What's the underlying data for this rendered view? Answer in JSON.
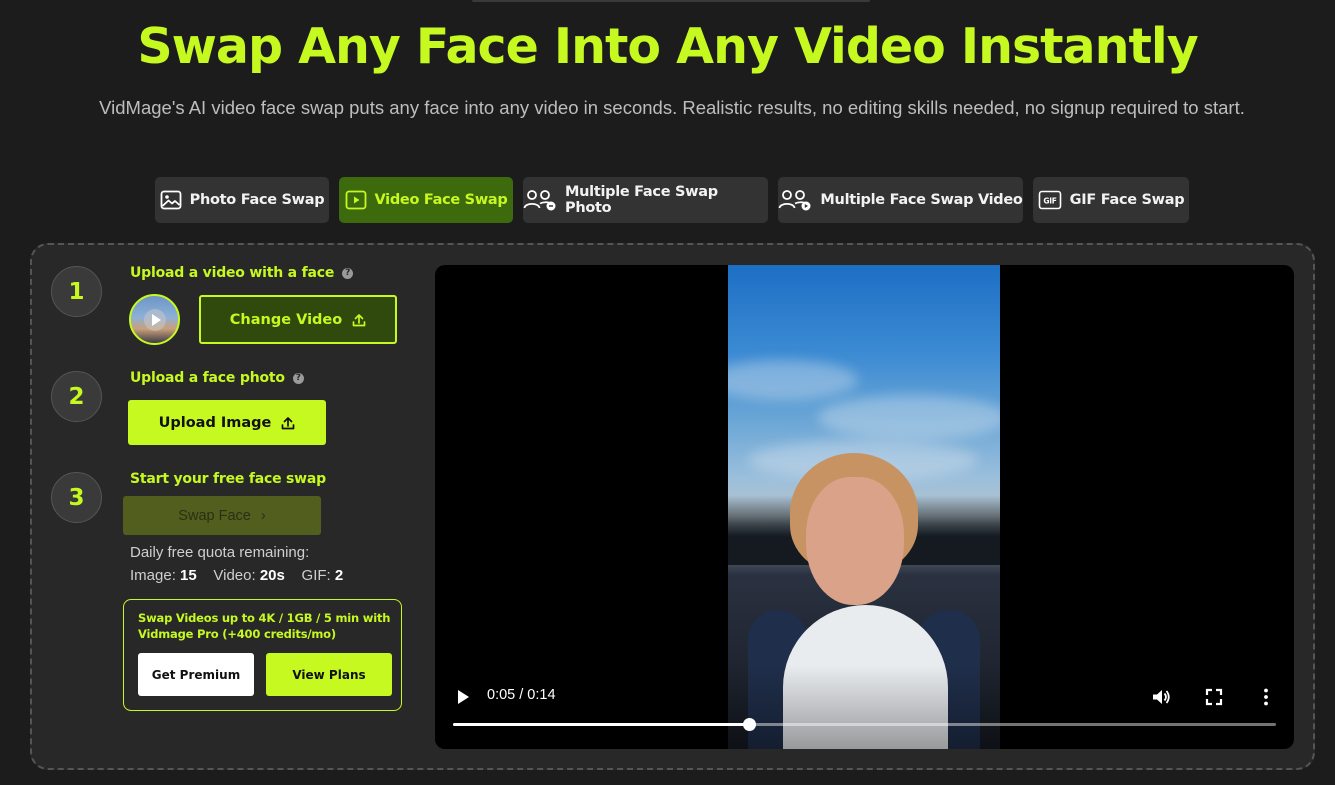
{
  "hero": {
    "title": "Swap Any Face Into Any Video Instantly",
    "subtitle": "VidMage's AI video face swap puts any face into any video in seconds. Realistic results, no editing skills needed, no signup required to start."
  },
  "tabs": [
    {
      "label": "Photo Face Swap",
      "icon": "image-icon",
      "active": false
    },
    {
      "label": "Video Face Swap",
      "icon": "video-icon",
      "active": true
    },
    {
      "label": "Multiple Face Swap Photo",
      "icon": "multi-user-icon",
      "active": false
    },
    {
      "label": "Multiple Face Swap Video",
      "icon": "multi-user-icon",
      "active": false
    },
    {
      "label": "GIF Face Swap",
      "icon": "gif-icon",
      "active": false
    }
  ],
  "steps": {
    "step1": {
      "number": "1",
      "label": "Upload a video with a face",
      "button": "Change Video"
    },
    "step2": {
      "number": "2",
      "label": "Upload a face photo",
      "button": "Upload Image"
    },
    "step3": {
      "number": "3",
      "label": "Start your free face swap",
      "button": "Swap Face",
      "button_suffix": "›"
    }
  },
  "help_glyph": "?",
  "quota": {
    "title": "Daily free quota remaining:",
    "image_label": "Image:",
    "image_value": "15",
    "video_label": "Video:",
    "video_value": "20s",
    "gif_label": "GIF:",
    "gif_value": "2"
  },
  "promo": {
    "text": "Swap Videos up to 4K / 1GB / 5 min with Vidmage Pro (+400 credits/mo)",
    "premium_button": "Get Premium",
    "plans_button": "View Plans"
  },
  "player": {
    "time": "0:05 / 0:14",
    "progress": 0.36
  },
  "colors": {
    "accent": "#c6f91f",
    "active_tab_bg": "#3c6a0c",
    "background": "#1c1c1c",
    "panel": "#282828"
  }
}
